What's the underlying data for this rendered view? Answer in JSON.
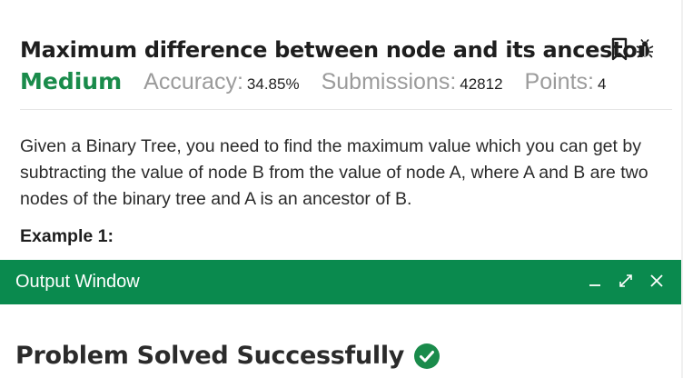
{
  "problem": {
    "title": "Maximum difference between node and its ancestor",
    "difficulty": "Medium",
    "accuracy_label": "Accuracy:",
    "accuracy_value": "34.85%",
    "submissions_label": "Submissions:",
    "submissions_value": "42812",
    "points_label": "Points:",
    "points_value": "4",
    "description": "Given a Binary Tree, you need to find the maximum value which you can get by subtracting the value of node B from the value of node A, where A and B are two nodes of the binary tree and A is an ancestor of B.",
    "example_heading": "Example 1:"
  },
  "output_window": {
    "title": "Output Window",
    "result": "Problem Solved Successfully"
  },
  "icons": {
    "bookmark": "bookmark-icon",
    "bug": "bug-icon",
    "minimize": "minimize-icon",
    "expand": "expand-icon",
    "close": "close-icon",
    "success": "check-circle-icon"
  },
  "colors": {
    "accent_green": "#1a8b4b",
    "output_bar": "#0a8a4e",
    "muted_label": "#9b9b9b"
  }
}
